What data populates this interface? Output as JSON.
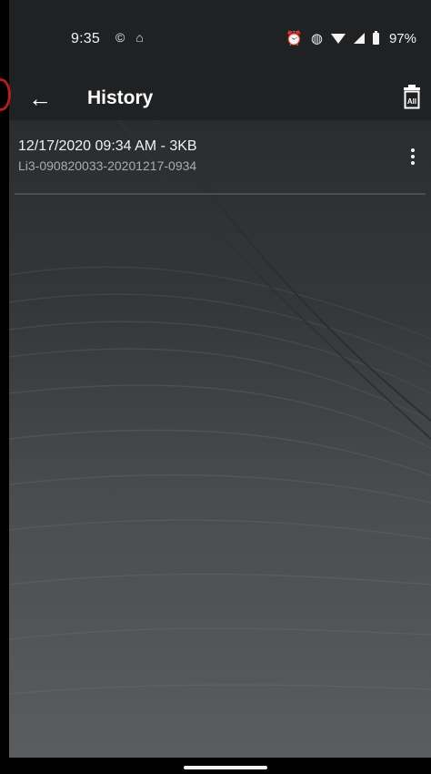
{
  "status_bar": {
    "time": "9:35",
    "battery": "97%",
    "left_icons": [
      "©",
      "⌂"
    ],
    "right_icons": [
      "alarm-icon",
      "vibrate-icon",
      "wifi-icon",
      "signal-icon",
      "battery-icon"
    ]
  },
  "app_bar": {
    "title": "History",
    "back_icon": "←",
    "delete_all_label": "All"
  },
  "history": {
    "items": [
      {
        "title": "12/17/2020   09:34 AM - 3KB",
        "subtitle": "Li3-090820033-20201217-0934"
      }
    ]
  }
}
